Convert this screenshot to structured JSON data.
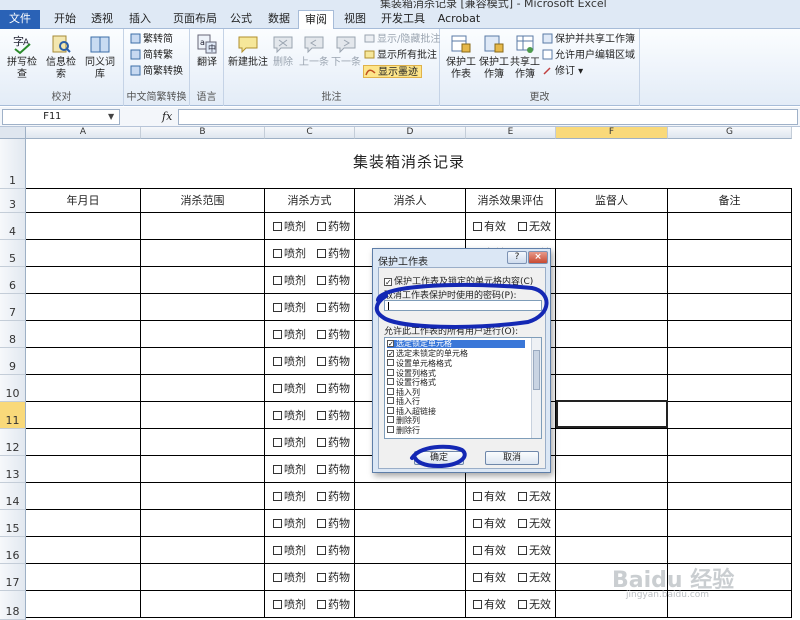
{
  "window": {
    "title": "集装箱消杀记录 [兼容模式] - Microsoft Excel"
  },
  "tabs": [
    "文件",
    "开始",
    "插入",
    "页面布局",
    "公式",
    "数据",
    "审阅",
    "视图",
    "开发工具",
    "Acrobat"
  ],
  "active_tab": "审阅",
  "ribbon": {
    "proofing": {
      "label": "校对",
      "spell": "拼写检查",
      "research": "信息检索",
      "thesaurus": "同义词库"
    },
    "chinese": {
      "label": "中文简繁转换",
      "to_trad": "繁转简",
      "to_simp": "简转繁",
      "convert": "简繁转换"
    },
    "language": {
      "label": "语言",
      "translate": "翻译"
    },
    "comments": {
      "label": "批注",
      "new": "新建批注",
      "delete": "删除",
      "prev": "上一条",
      "next": "下一条",
      "show_hide": "显示/隐藏批注",
      "show_all": "显示所有批注",
      "show_ink": "显示墨迹"
    },
    "changes": {
      "label": "更改",
      "protect_sheet": "保护工作表",
      "protect_book": "保护工作簿",
      "share_book": "共享工作簿",
      "protect_share": "保护并共享工作簿",
      "allow_edit": "允许用户编辑区域",
      "track": "修订"
    }
  },
  "formula_bar": {
    "name_box": "F11",
    "fx": "fx",
    "formula": ""
  },
  "columns": [
    "A",
    "B",
    "C",
    "D",
    "E",
    "F",
    "G"
  ],
  "selected_column": "F",
  "selected_row": "11",
  "rows": [
    "1",
    "3",
    "4",
    "5",
    "6",
    "7",
    "8",
    "9",
    "10",
    "11",
    "12",
    "13",
    "14",
    "15",
    "16",
    "17",
    "18"
  ],
  "sheet": {
    "title": "集装箱消杀记录",
    "headers": [
      "年月日",
      "消杀范围",
      "消杀方式",
      "消杀人",
      "消杀效果评估",
      "监督人",
      "备注"
    ],
    "method_options": [
      "喷剂",
      "药物"
    ],
    "effect_options": [
      "有效",
      "无效"
    ]
  },
  "dialog": {
    "title": "保护工作表",
    "help": "?",
    "close": "×",
    "protect_check": "保护工作表及锁定的单元格内容(C)",
    "password_label": "取消工作表保护时使用的密码(P):",
    "password_value": "",
    "allow_label": "允许此工作表的所有用户进行(O):",
    "permissions": [
      {
        "label": "选定锁定单元格",
        "checked": true
      },
      {
        "label": "选定未锁定的单元格",
        "checked": true
      },
      {
        "label": "设置单元格格式",
        "checked": false
      },
      {
        "label": "设置列格式",
        "checked": false
      },
      {
        "label": "设置行格式",
        "checked": false
      },
      {
        "label": "插入列",
        "checked": false
      },
      {
        "label": "插入行",
        "checked": false
      },
      {
        "label": "插入超链接",
        "checked": false
      },
      {
        "label": "删除列",
        "checked": false
      },
      {
        "label": "删除行",
        "checked": false
      }
    ],
    "ok": "确定",
    "cancel": "取消"
  },
  "watermark": {
    "brand": "Baidu 经验",
    "site": "jingyan.baidu.com"
  },
  "colors": {
    "file_tab": "#2a62b6",
    "selection": "#f9d97a",
    "ink": "#1428b4"
  }
}
